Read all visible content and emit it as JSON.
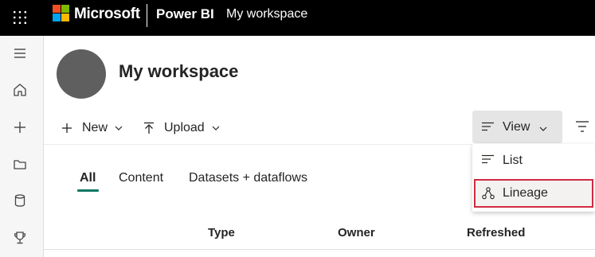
{
  "header": {
    "brand": "Microsoft",
    "product": "Power BI",
    "breadcrumb": "My workspace",
    "logo_colors": [
      "#f25022",
      "#7fba00",
      "#00a4ef",
      "#ffb900"
    ]
  },
  "leftnav": {
    "items": [
      {
        "icon": "hamburger-icon"
      },
      {
        "icon": "home-icon"
      },
      {
        "icon": "plus-icon"
      },
      {
        "icon": "folder-icon"
      },
      {
        "icon": "database-icon"
      },
      {
        "icon": "trophy-icon"
      }
    ]
  },
  "workspace": {
    "title": "My workspace"
  },
  "toolbar": {
    "new_label": "New",
    "upload_label": "Upload",
    "view_label": "View"
  },
  "tabs": [
    {
      "label": "All",
      "active": true
    },
    {
      "label": "Content",
      "active": false
    },
    {
      "label": "Datasets + dataflows",
      "active": false
    }
  ],
  "table": {
    "columns": [
      "Type",
      "Owner",
      "Refreshed"
    ]
  },
  "view_menu": {
    "items": [
      {
        "label": "List",
        "icon": "list-icon",
        "highlighted": false
      },
      {
        "label": "Lineage",
        "icon": "lineage-icon",
        "highlighted": true
      }
    ]
  },
  "colors": {
    "accent": "#117865",
    "highlight_border": "#d12a41"
  }
}
